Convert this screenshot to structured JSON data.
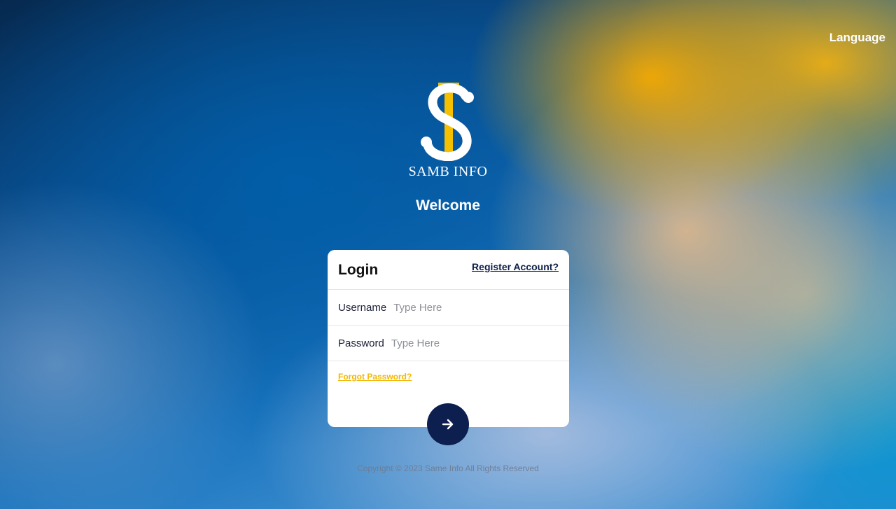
{
  "header": {
    "language_label": "Language"
  },
  "brand": {
    "name": "SAMB INFO",
    "colors": {
      "gold": "#f5c000",
      "white": "#ffffff"
    }
  },
  "welcome": "Welcome",
  "login": {
    "title": "Login",
    "register_label": "Register Account?",
    "username": {
      "label": "Username",
      "placeholder": "Type Here",
      "value": ""
    },
    "password": {
      "label": "Password",
      "placeholder": "Type Here",
      "value": ""
    },
    "forgot_label": "Forgot Password?",
    "submit_icon": "arrow-right-icon"
  },
  "footer": {
    "copyright": "Copyright © 2023 Same Info All Rights Reserved"
  },
  "colors": {
    "accent_navy": "#0c1f4e",
    "link_gold": "#f2b705"
  }
}
